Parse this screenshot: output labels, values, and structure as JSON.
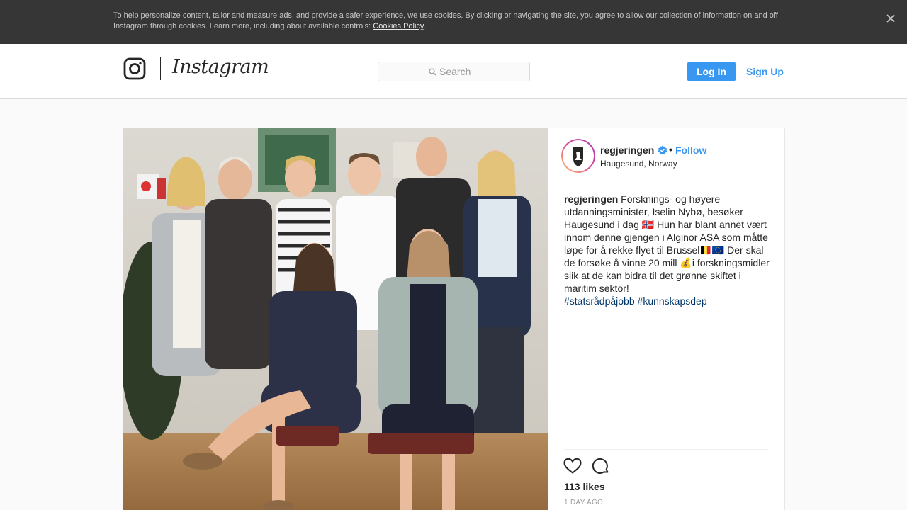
{
  "cookie_banner": {
    "text": "To help personalize content, tailor and measure ads, and provide a safer experience, we use cookies. By clicking or navigating the site, you agree to allow our collection of information on and off Instagram through cookies. Learn more, including about available controls: ",
    "link_label": "Cookies Policy",
    "suffix": ".",
    "close_icon": "close-icon"
  },
  "header": {
    "wordmark": "Instagram",
    "logo_icon": "instagram-camera-icon",
    "search_placeholder": "Search",
    "search_icon": "search-icon",
    "login_label": "Log In",
    "signup_label": "Sign Up"
  },
  "post": {
    "photo_alt": "Group photo of eight people in an office",
    "username": "regjeringen",
    "verified_icon": "verified-badge-icon",
    "separator": "•",
    "follow_label": "Follow",
    "location": "Haugesund, Norway",
    "caption_user": "regjeringen",
    "caption_text": "Forsknings- og høyere utdanningsminister, Iselin Nybø, besøker Haugesund i dag 🇳🇴 Hun har blant annet vært innom denne gjengen i Alginor ASA som måtte løpe for å rekke flyet til Brussel🇧🇪🇪🇺 Der skal de forsøke å vinne 20 mill 💰i forskningsmidler slik at de kan bidra til det grønne skiftet i maritim sektor!",
    "hashtags": [
      "#statsrådpåjobb",
      "#kunnskapsdep"
    ],
    "likes": "113 likes",
    "timestamp": "1 DAY AGO",
    "like_icon": "heart-icon",
    "comment_icon": "comment-icon"
  },
  "colors": {
    "accent": "#3897f0",
    "banner_bg": "#363636",
    "hashtag": "#003569"
  }
}
